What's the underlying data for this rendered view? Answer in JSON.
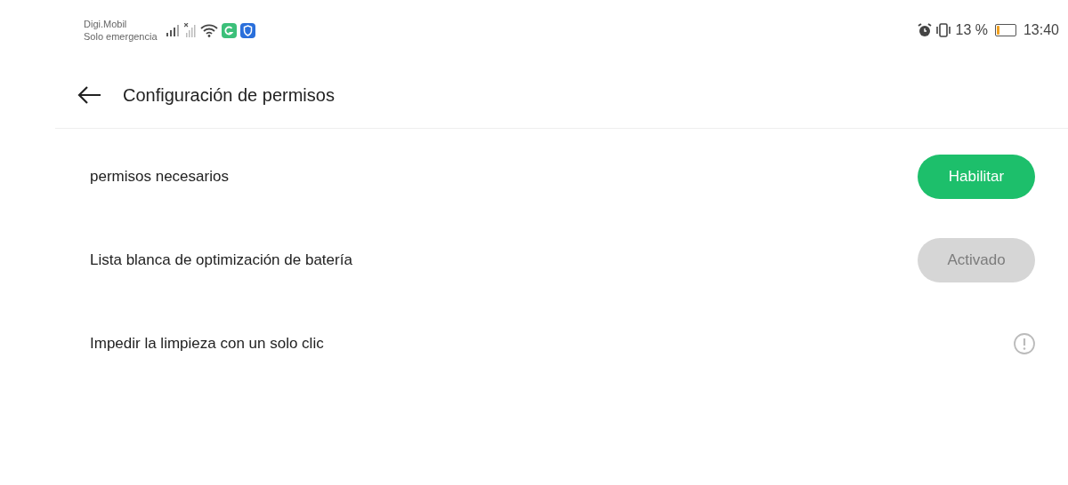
{
  "status_bar": {
    "carrier": "Digi.Mobil",
    "carrier_status": "Solo emergencia",
    "battery_percent": "13 %",
    "time": "13:40"
  },
  "header": {
    "title": "Configuración de permisos"
  },
  "rows": [
    {
      "label": "permisos necesarios",
      "kind": "button",
      "button_label": "Habilitar",
      "disabled": false
    },
    {
      "label": "Lista blanca de optimización de batería",
      "kind": "button",
      "button_label": "Activado",
      "disabled": true
    },
    {
      "label": "Impedir la limpieza con un solo clic",
      "kind": "info"
    }
  ]
}
